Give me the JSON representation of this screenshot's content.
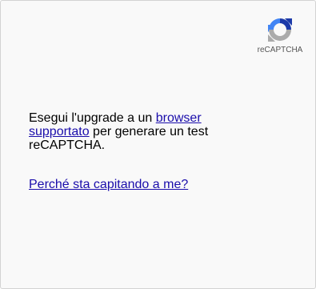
{
  "logo": {
    "icon": "recaptcha-logo-icon",
    "text": "reCAPTCHA",
    "colors": {
      "blue_dark": "#1c3aa9",
      "blue_light": "#4285f4",
      "gray": "#ababab"
    }
  },
  "message": {
    "part1": "Esegui l'upgrade a un ",
    "link": "browser supportato",
    "part2": " per generare un test reCAPTCHA."
  },
  "help_link": {
    "label": "Perché sta capitando a me?"
  },
  "colors": {
    "background": "#f9f9f9",
    "border": "#d3d3d3",
    "link": "#1a0dab"
  }
}
